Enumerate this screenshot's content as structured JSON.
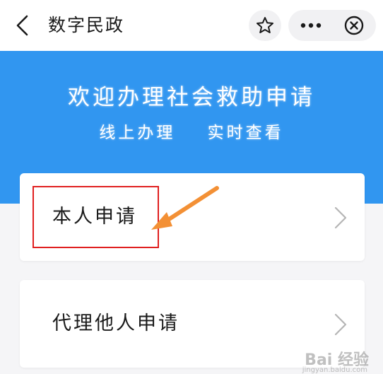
{
  "header": {
    "title": "数字民政",
    "back_icon": "chevron-left-icon",
    "favorite_icon": "star-icon",
    "more_icon": "more-dots-icon",
    "close_icon": "close-circle-icon"
  },
  "banner": {
    "title": "欢迎办理社会救助申请",
    "subtitle_1": "线上办理",
    "subtitle_2": "实时查看",
    "color": "#3196f0"
  },
  "options": [
    {
      "label": "本人申请",
      "icon": "chevron-right-icon"
    },
    {
      "label": "代理他人申请",
      "icon": "chevron-right-icon"
    }
  ],
  "annotations": {
    "highlight_color": "#e02020",
    "arrow_color": "#f39035"
  },
  "watermark": {
    "text": "Bai 经验",
    "url": "jingyan.baidu.com"
  }
}
